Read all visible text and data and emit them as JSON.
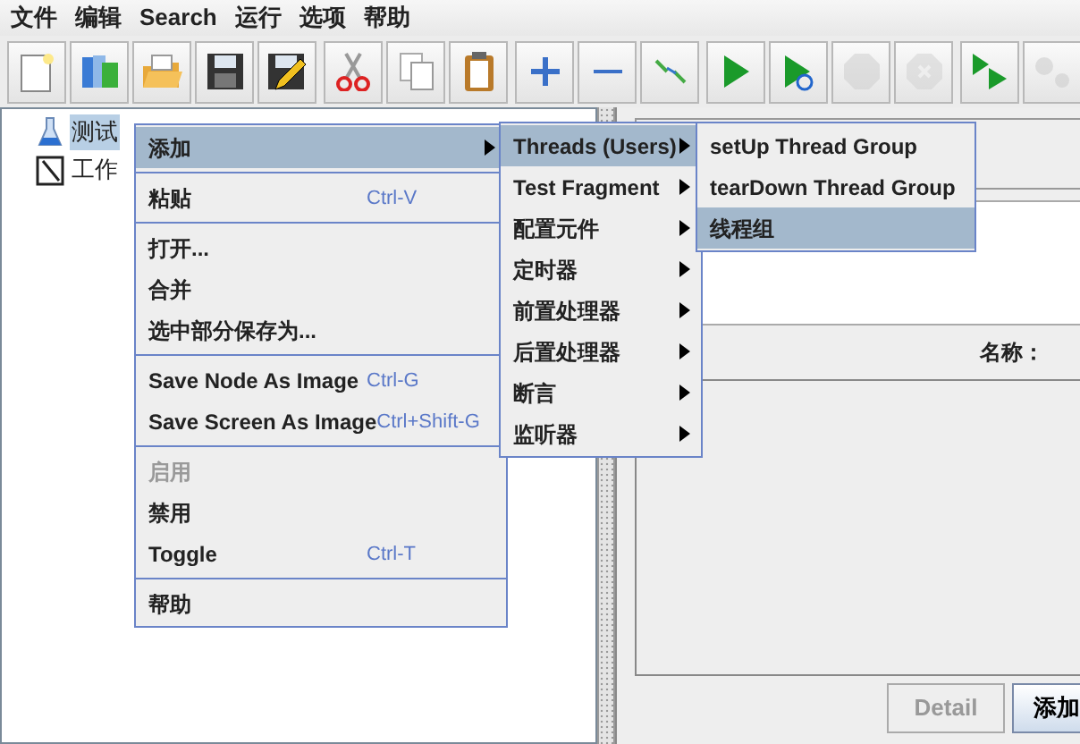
{
  "menu_bar": [
    {
      "label": "文件"
    },
    {
      "label": "编辑"
    },
    {
      "label": "Search"
    },
    {
      "label": "运行"
    },
    {
      "label": "选项"
    },
    {
      "label": "帮助"
    }
  ],
  "toolbar": [
    {
      "kind": "new",
      "disabled": false
    },
    {
      "kind": "templates",
      "disabled": false
    },
    {
      "kind": "open",
      "disabled": false
    },
    {
      "kind": "save",
      "disabled": false
    },
    {
      "kind": "save-as",
      "disabled": false
    },
    {
      "kind": "sep"
    },
    {
      "kind": "cut",
      "disabled": false
    },
    {
      "kind": "copy",
      "disabled": false
    },
    {
      "kind": "paste",
      "disabled": false
    },
    {
      "kind": "sep"
    },
    {
      "kind": "expand",
      "disabled": false
    },
    {
      "kind": "collapse",
      "disabled": false
    },
    {
      "kind": "toggle",
      "disabled": false
    },
    {
      "kind": "sep"
    },
    {
      "kind": "start",
      "disabled": false
    },
    {
      "kind": "start-no-pause",
      "disabled": false
    },
    {
      "kind": "stop",
      "disabled": true
    },
    {
      "kind": "shutdown",
      "disabled": true
    },
    {
      "kind": "sep"
    },
    {
      "kind": "remote-start",
      "disabled": false
    },
    {
      "kind": "remote-stop",
      "disabled": true
    }
  ],
  "tree": [
    {
      "label": "测试",
      "kind": "plan",
      "selected": true
    },
    {
      "label": "工作",
      "kind": "workbench",
      "selected": false
    }
  ],
  "context_menu": [
    {
      "kind": "item",
      "label": "添加",
      "submenu": true,
      "selected": true,
      "disabled": false
    },
    {
      "kind": "separator"
    },
    {
      "kind": "item",
      "label": "粘贴",
      "shortcut": "Ctrl-V",
      "selected": false,
      "disabled": false
    },
    {
      "kind": "separator"
    },
    {
      "kind": "item",
      "label": "打开...",
      "selected": false,
      "disabled": false
    },
    {
      "kind": "item",
      "label": "合并",
      "selected": false,
      "disabled": false
    },
    {
      "kind": "item",
      "label": "选中部分保存为...",
      "selected": false,
      "disabled": false
    },
    {
      "kind": "separator"
    },
    {
      "kind": "item",
      "label": "Save Node As Image",
      "shortcut": "Ctrl-G",
      "selected": false,
      "disabled": false
    },
    {
      "kind": "item",
      "label": "Save Screen As Image",
      "shortcut": "Ctrl+Shift-G",
      "selected": false,
      "disabled": false
    },
    {
      "kind": "separator"
    },
    {
      "kind": "item",
      "label": "启用",
      "selected": false,
      "disabled": true
    },
    {
      "kind": "item",
      "label": "禁用",
      "selected": false,
      "disabled": false
    },
    {
      "kind": "item",
      "label": "Toggle",
      "shortcut": "Ctrl-T",
      "selected": false,
      "disabled": false
    },
    {
      "kind": "separator"
    },
    {
      "kind": "item",
      "label": "帮助",
      "selected": false,
      "disabled": false
    }
  ],
  "add_submenu": [
    {
      "label": "Threads (Users)",
      "submenu": true,
      "selected": true
    },
    {
      "label": "Test Fragment",
      "submenu": true,
      "selected": false
    },
    {
      "label": "配置元件",
      "submenu": true,
      "selected": false
    },
    {
      "label": "定时器",
      "submenu": true,
      "selected": false
    },
    {
      "label": "前置处理器",
      "submenu": true,
      "selected": false
    },
    {
      "label": "后置处理器",
      "submenu": true,
      "selected": false
    },
    {
      "label": "断言",
      "submenu": true,
      "selected": false
    },
    {
      "label": "监听器",
      "submenu": true,
      "selected": false
    }
  ],
  "threads_submenu": [
    {
      "label": "setUp Thread Group",
      "selected": false
    },
    {
      "label": "tearDown Thread Group",
      "selected": false
    },
    {
      "label": "线程组",
      "selected": true
    }
  ],
  "right_panel": {
    "name_label": "名称：",
    "buttons": [
      {
        "label": "Detail",
        "disabled": true
      },
      {
        "label": "添加",
        "disabled": false
      }
    ]
  }
}
